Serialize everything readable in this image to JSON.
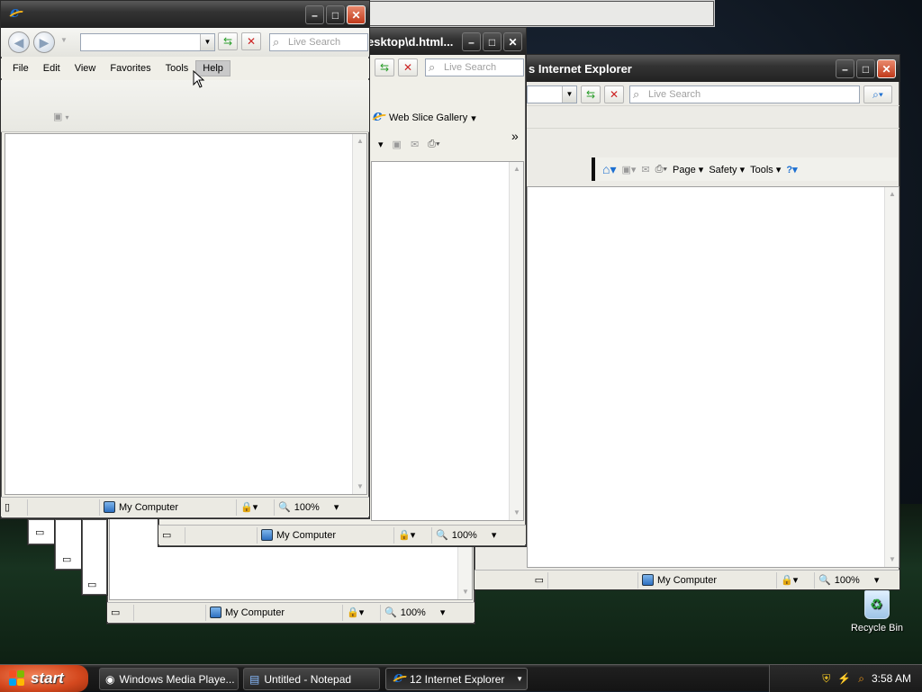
{
  "desktop": {
    "recycle_bin_label": "Recycle Bin"
  },
  "windows": {
    "front": {
      "search_placeholder": "Live Search",
      "menu": [
        "File",
        "Edit",
        "View",
        "Favorites",
        "Tools",
        "Help"
      ],
      "status_zone": "My Computer",
      "zoom": "100%"
    },
    "middle": {
      "title": "esktop\\d.html...",
      "search_placeholder": "Live Search",
      "favorites_link": "Web Slice Gallery",
      "chevron": "»",
      "status_zone": "My Computer",
      "zoom": "100%"
    },
    "right": {
      "title": "s Internet Explorer",
      "search_placeholder": "Live Search",
      "cmd_page": "Page",
      "cmd_safety": "Safety",
      "cmd_tools": "Tools",
      "status_zone": "My Computer",
      "zoom": "100%"
    },
    "back": {
      "status_zone": "My Computer",
      "zoom": "100%"
    }
  },
  "taskbar": {
    "start_label": "start",
    "tasks": [
      {
        "label": "Windows Media Playe..."
      },
      {
        "label": "Untitled - Notepad"
      },
      {
        "label": "12 Internet Explorer"
      }
    ],
    "clock": "3:58 AM"
  },
  "colors": {
    "start_orange": "#d4481e",
    "accent_blue": "#1c6fd1"
  }
}
